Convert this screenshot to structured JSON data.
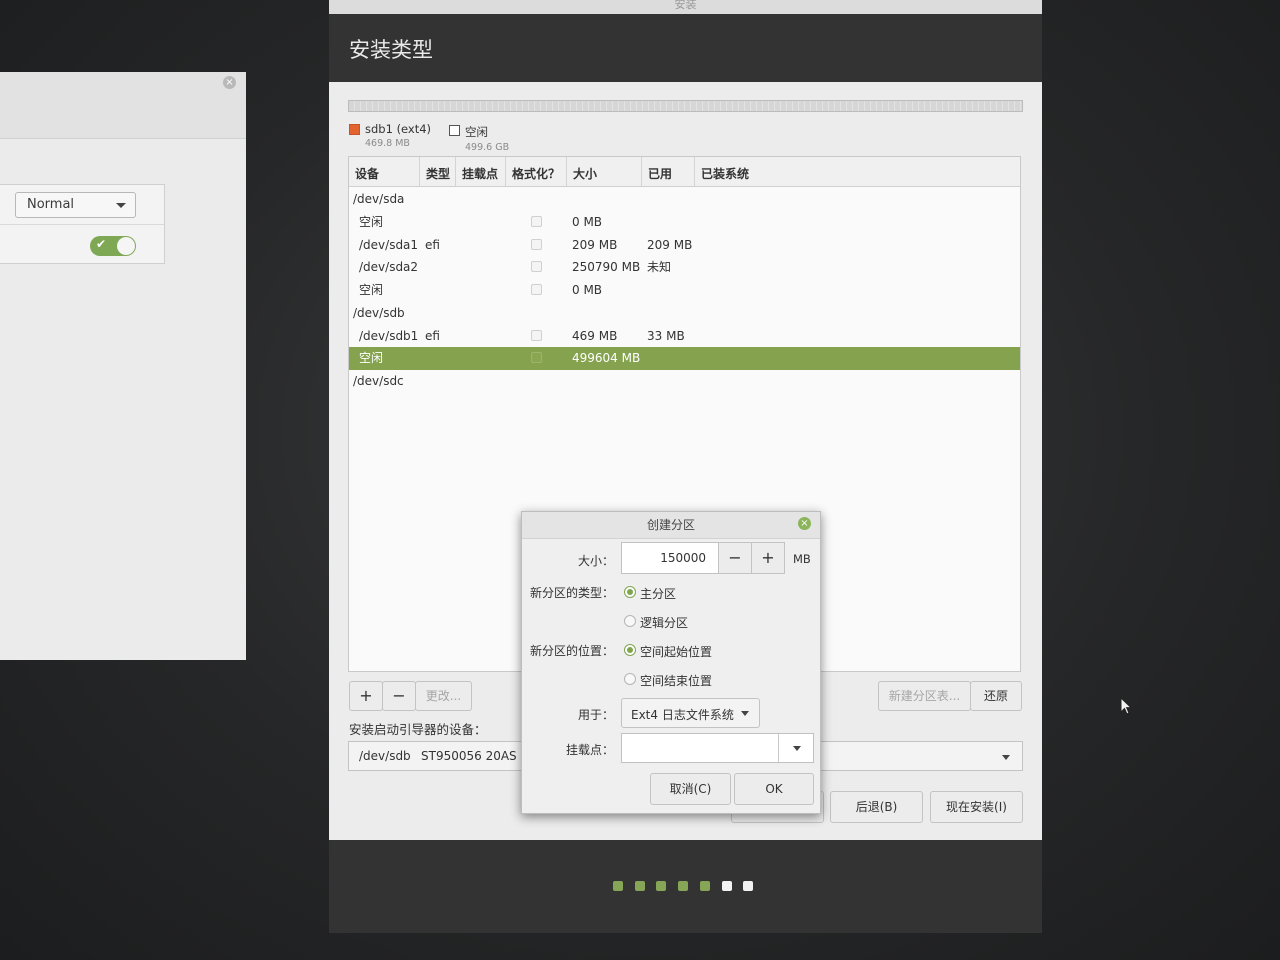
{
  "background_window": {
    "dropdown_value": "Normal",
    "toggle_on": true
  },
  "installer": {
    "window_title": "安装",
    "heading": "安装类型",
    "partition_legend": [
      {
        "name": "sdb1 (ext4)",
        "size": "469.8 MB",
        "color": "#e3632f"
      },
      {
        "name": "空闲",
        "size": "499.6 GB",
        "color": "#ffffff"
      }
    ],
    "table": {
      "headers": [
        "设备",
        "类型",
        "挂载点",
        "格式化？",
        "大小",
        "已用",
        "已装系统"
      ],
      "rows": [
        {
          "device": "/dev/sda",
          "kind": "disk"
        },
        {
          "device": "空闲",
          "type": "",
          "format": false,
          "size": "0 MB",
          "used": ""
        },
        {
          "device": "/dev/sda1",
          "type": "efi",
          "format": false,
          "size": "209 MB",
          "used": "209 MB"
        },
        {
          "device": "/dev/sda2",
          "type": "",
          "format": false,
          "size": "250790 MB",
          "used": "未知"
        },
        {
          "device": "空闲",
          "type": "",
          "format": false,
          "size": "0 MB",
          "used": ""
        },
        {
          "device": "/dev/sdb",
          "kind": "disk"
        },
        {
          "device": "/dev/sdb1",
          "type": "efi",
          "format": false,
          "size": "469 MB",
          "used": "33 MB"
        },
        {
          "device": "空闲",
          "type": "",
          "format": false,
          "size": "499604 MB",
          "used": "",
          "selected": true
        },
        {
          "device": "/dev/sdc",
          "kind": "disk"
        }
      ]
    },
    "buttons": {
      "add": "+",
      "remove": "−",
      "change": "更改...",
      "new_table": "新建分区表...",
      "revert": "还原",
      "back": "后退(B)",
      "install_now": "现在安装(I)"
    },
    "bootloader_label": "安装启动引导器的设备：",
    "bootloader_device": "/dev/sdb",
    "bootloader_model": "ST950056 20AS (",
    "progress_dots": {
      "total": 7,
      "completed": 5,
      "colors": {
        "done": "#87a556",
        "todo": "#f2f2f2"
      }
    }
  },
  "dialog": {
    "title": "创建分区",
    "size_label": "大小：",
    "size_value": "150000",
    "size_unit": "MB",
    "minus": "−",
    "plus": "+",
    "type_label": "新分区的类型：",
    "type_primary": "主分区",
    "type_logical": "逻辑分区",
    "type_selected": "primary",
    "location_label": "新分区的位置：",
    "location_start": "空间起始位置",
    "location_end": "空间结束位置",
    "location_selected": "start",
    "use_label": "用于：",
    "use_value": "Ext4 日志文件系统",
    "mount_label": "挂载点：",
    "mount_value": "",
    "cancel": "取消(C)",
    "ok": "OK"
  }
}
